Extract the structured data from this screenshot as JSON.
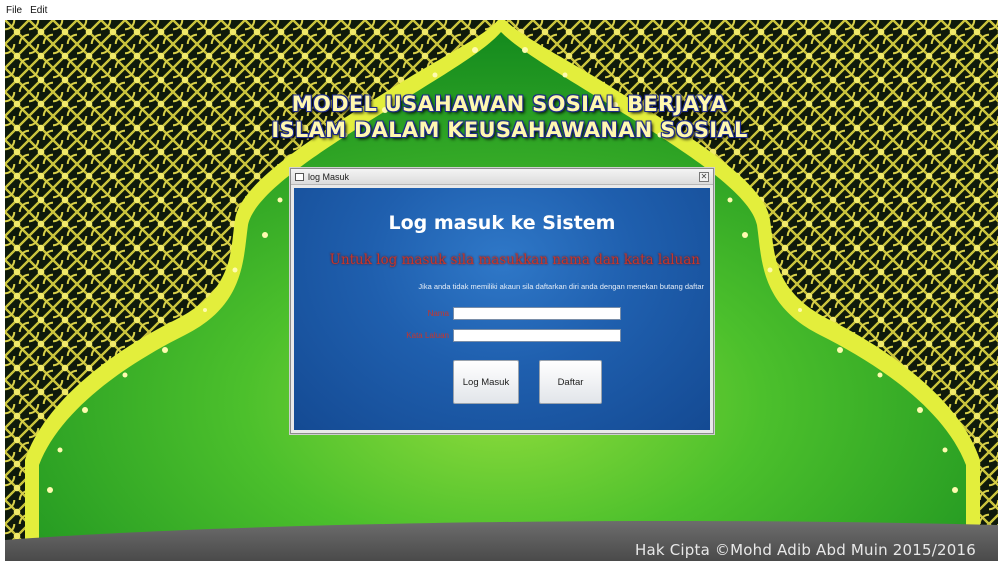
{
  "menubar": {
    "items": [
      "File",
      "Edit"
    ]
  },
  "background": {
    "headline_line1": "MODEL USAHAWAN SOSIAL BERJAYA",
    "headline_line2": "ISLAM DALAM KEUSAHAWANAN SOSIAL",
    "copyright": "Hak Cipta ©Mohd Adib Abd Muin 2015/2016"
  },
  "login_window": {
    "title": "log Masuk",
    "heading": "Log masuk ke Sistem",
    "subheading": "Untuk log masuk sila masukkan nama dan kata laluan",
    "note": "Jika anda tidak memiliki akaun sila daftarkan diri anda dengan menekan butang daftar",
    "name_label": "Nama",
    "name_value": "",
    "password_label": "Kata Laluan",
    "password_value": "",
    "login_button": "Log Masuk",
    "register_button": "Daftar"
  },
  "colors": {
    "panel_blue": "#1f5fae",
    "accent_red": "#c7352b",
    "arch_green": "#3fb52a",
    "arch_border_yellow": "#e6ef3a"
  }
}
